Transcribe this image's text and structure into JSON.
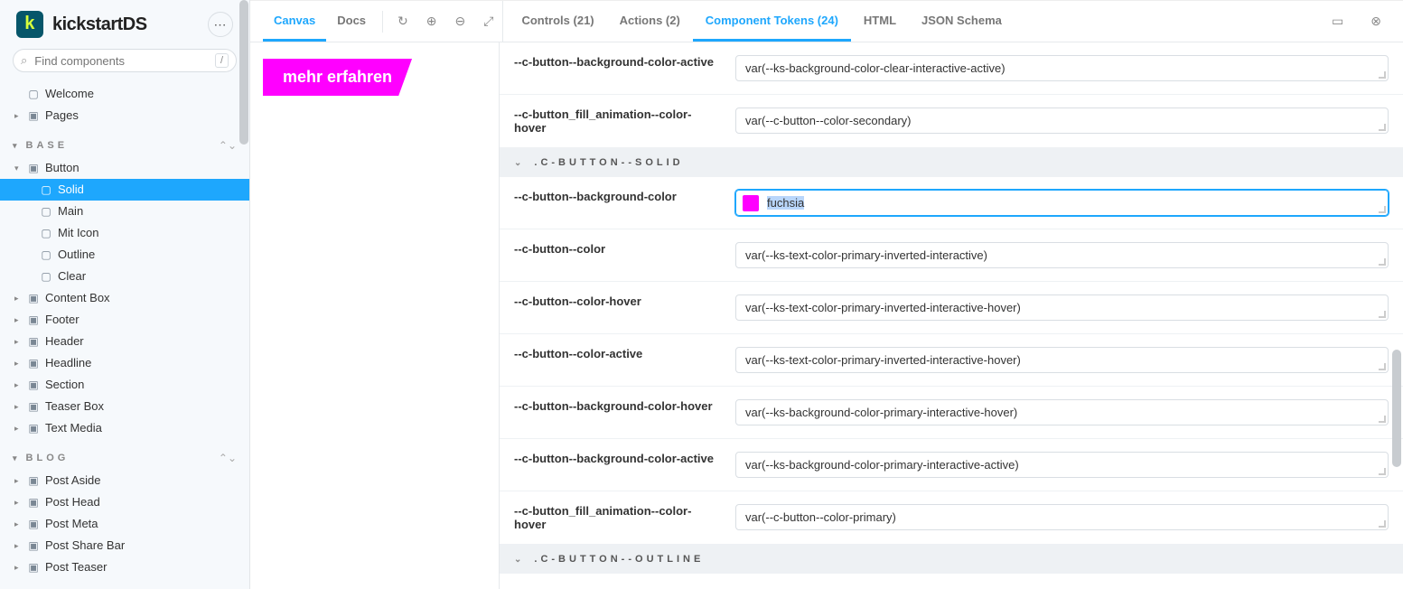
{
  "brand": {
    "name": "kickstartDS",
    "mark": "k"
  },
  "search": {
    "placeholder": "Find components",
    "shortcut": "/"
  },
  "sidebar": {
    "top": [
      {
        "label": "Welcome",
        "icon": "▢"
      },
      {
        "label": "Pages",
        "icon": "▣",
        "caret": "▸"
      }
    ],
    "sections": [
      {
        "title": "BASE",
        "items": [
          {
            "label": "Button",
            "icon": "▣",
            "caret": "▾",
            "expanded": true,
            "children": [
              {
                "label": "Solid",
                "icon": "▢",
                "active": true
              },
              {
                "label": "Main",
                "icon": "▢"
              },
              {
                "label": "Mit Icon",
                "icon": "▢"
              },
              {
                "label": "Outline",
                "icon": "▢"
              },
              {
                "label": "Clear",
                "icon": "▢"
              }
            ]
          },
          {
            "label": "Content Box",
            "icon": "▣",
            "caret": "▸"
          },
          {
            "label": "Footer",
            "icon": "▣",
            "caret": "▸"
          },
          {
            "label": "Header",
            "icon": "▣",
            "caret": "▸"
          },
          {
            "label": "Headline",
            "icon": "▣",
            "caret": "▸"
          },
          {
            "label": "Section",
            "icon": "▣",
            "caret": "▸"
          },
          {
            "label": "Teaser Box",
            "icon": "▣",
            "caret": "▸"
          },
          {
            "label": "Text Media",
            "icon": "▣",
            "caret": "▸"
          }
        ]
      },
      {
        "title": "BLOG",
        "items": [
          {
            "label": "Post Aside",
            "icon": "▣",
            "caret": "▸"
          },
          {
            "label": "Post Head",
            "icon": "▣",
            "caret": "▸"
          },
          {
            "label": "Post Meta",
            "icon": "▣",
            "caret": "▸"
          },
          {
            "label": "Post Share Bar",
            "icon": "▣",
            "caret": "▸"
          },
          {
            "label": "Post Teaser",
            "icon": "▣",
            "caret": "▸"
          }
        ]
      }
    ]
  },
  "topbar": {
    "left_tabs": [
      {
        "label": "Canvas",
        "active": true
      },
      {
        "label": "Docs"
      }
    ],
    "panel_tabs": [
      {
        "label": "Controls (21)"
      },
      {
        "label": "Actions (2)"
      },
      {
        "label": "Component Tokens (24)",
        "active": true
      },
      {
        "label": "HTML"
      },
      {
        "label": "JSON Schema"
      }
    ]
  },
  "preview": {
    "button_label": "mehr erfahren",
    "bg": "#ff00ff"
  },
  "tokens": {
    "pre_rows": [
      {
        "name": "--c-button--background-color-active",
        "value": "var(--ks-background-color-clear-interactive-active)"
      },
      {
        "name": "--c-button_fill_animation--color-hover",
        "value": "var(--c-button--color-secondary)"
      }
    ],
    "groups": [
      {
        "title": ".C-BUTTON--SOLID",
        "rows": [
          {
            "name": "--c-button--background-color",
            "value": "fuchsia",
            "swatch": "#ff00ff",
            "focused": true,
            "selected": true
          },
          {
            "name": "--c-button--color",
            "value": "var(--ks-text-color-primary-inverted-interactive)"
          },
          {
            "name": "--c-button--color-hover",
            "value": "var(--ks-text-color-primary-inverted-interactive-hover)"
          },
          {
            "name": "--c-button--color-active",
            "value": "var(--ks-text-color-primary-inverted-interactive-hover)"
          },
          {
            "name": "--c-button--background-color-hover",
            "value": "var(--ks-background-color-primary-interactive-hover)"
          },
          {
            "name": "--c-button--background-color-active",
            "value": "var(--ks-background-color-primary-interactive-active)"
          },
          {
            "name": "--c-button_fill_animation--color-hover",
            "value": "var(--c-button--color-primary)"
          }
        ]
      },
      {
        "title": ".C-BUTTON--OUTLINE",
        "rows": []
      }
    ]
  }
}
